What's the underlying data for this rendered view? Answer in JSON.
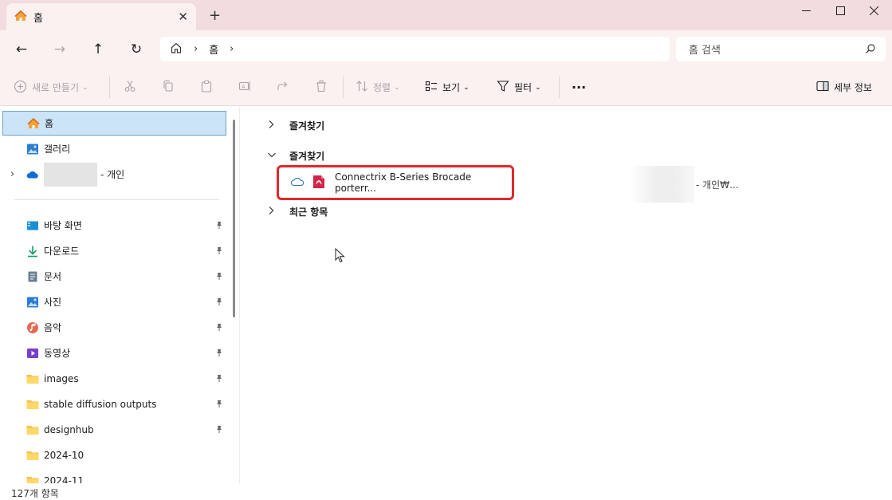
{
  "window": {
    "tab_title": "홈",
    "close_glyph": "✕",
    "newtab_glyph": "+",
    "minimize_glyph": "—",
    "maximize_glyph": "☐",
    "winclose_glyph": "✕"
  },
  "nav": {
    "back_glyph": "←",
    "forward_glyph": "→",
    "up_glyph": "↑",
    "refresh_glyph": "↻"
  },
  "address": {
    "crumb": "홈",
    "sep": "›"
  },
  "search": {
    "placeholder": "홈 검색"
  },
  "toolbar": {
    "new_label": "새로 만들기",
    "sort_label": "정렬",
    "view_label": "보기",
    "filter_label": "필터",
    "more_label": "···",
    "details_label": "세부 정보",
    "chevron": "⌄"
  },
  "sidebar": {
    "items": [
      {
        "label": "홈",
        "icon": "home-icon",
        "selected": true
      },
      {
        "label": "갤러리",
        "icon": "gallery-icon"
      },
      {
        "label": "- 개인",
        "icon": "onedrive-cloud-icon"
      },
      {
        "label": "바탕 화면",
        "icon": "desktop-icon",
        "pinned": true
      },
      {
        "label": "다운로드",
        "icon": "download-icon",
        "pinned": true
      },
      {
        "label": "문서",
        "icon": "document-icon",
        "pinned": true
      },
      {
        "label": "사진",
        "icon": "pictures-icon",
        "pinned": true
      },
      {
        "label": "음악",
        "icon": "music-icon",
        "pinned": true
      },
      {
        "label": "동영상",
        "icon": "video-icon",
        "pinned": true
      },
      {
        "label": "images",
        "icon": "folder-icon",
        "pinned": true
      },
      {
        "label": "stable diffusion outputs",
        "icon": "folder-icon",
        "pinned": true
      },
      {
        "label": "designhub",
        "icon": "folder-icon",
        "pinned": true
      },
      {
        "label": "2024-10",
        "icon": "folder-icon"
      },
      {
        "label": "2024-11",
        "icon": "folder-icon"
      }
    ],
    "expand_glyph": "›"
  },
  "content": {
    "groups": [
      {
        "label": "즐겨찾기",
        "expanded": false,
        "chevron": "›"
      },
      {
        "label": "즐겨찾기",
        "expanded": true,
        "chevron": "⌄"
      },
      {
        "label": "최근 항목",
        "expanded": false,
        "chevron": "›"
      }
    ],
    "file": {
      "name": "Connectrix B-Series Brocade porterr...",
      "location_suffix": "- 개인₩...",
      "icon": "pdf-file-icon",
      "status_icon": "cloud-icon"
    }
  },
  "status": {
    "count": "127개 항목"
  },
  "colors": {
    "accent": "#0067c0",
    "titlebar": "#f2dcdd",
    "toolbar": "#fbf1f1",
    "selection": "#cce4f7",
    "highlight": "#e02a2a"
  }
}
